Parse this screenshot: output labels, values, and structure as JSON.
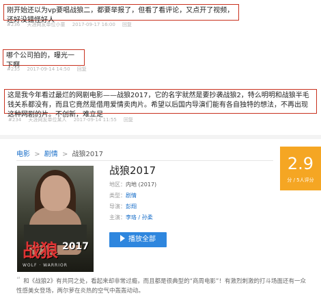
{
  "comments": [
    {
      "text": "刚开始还以为vp要唱战狼二，都要举报了，但看了看评论，又点开了视频，还好没错怪好人",
      "meta": [
        "#236",
        "天涯网友单位小童",
        "2017-09-17 16:00",
        "回复"
      ]
    },
    {
      "text": "哪个公司拍的，曝光一下啊",
      "meta": [
        "#235",
        "2017-09-14 14:50",
        "回复"
      ]
    },
    {
      "text": "这是我今年看过最烂的网剧电影——战狼2017，它的名字就然是要抄袭战狼2，特么明明和战狼半毛钱关系都没有，而且它竟然是借用爱情卖肉片。希望以后国内导演们能有各自独特的想法，不再出现这种网剧的片。不创新，难立足",
      "meta": [
        "#234",
        "天涯网友单位某人",
        "2017-09-14 11:55",
        "回复"
      ]
    }
  ],
  "breadcrumb": {
    "root": "电影",
    "sep": ">",
    "category": "剧情",
    "current": "战狼2017"
  },
  "movie": {
    "title": "战狼2017",
    "poster_title": "战狼",
    "poster_year": "2017",
    "poster_caption": "WOLF · WARRIOR",
    "fields": [
      {
        "key": "地区：",
        "value": "内地",
        "extra": "(2017)"
      },
      {
        "key": "类型：",
        "value": "剧情",
        "extra": ""
      },
      {
        "key": "导演：",
        "value": "彭翔",
        "extra": ""
      },
      {
        "key": "主演：",
        "value": "李珞 / 孙柔",
        "extra": ""
      }
    ],
    "play_label": "播放全部",
    "rating": "2.9",
    "rating_label": "分 / 5人评分",
    "quote": "和《战狼2》有共同之处，看起来却非常过瘾，而且都是很典型的“商周电影”！有激烈刺激的打斗场面还有一众性感美女登场，两尔萝在炎热的空气中轰轰动动。"
  },
  "colors": {
    "accent": "#2e86de",
    "rating_bg": "#f5a623",
    "comment_border": "#c8301d"
  }
}
